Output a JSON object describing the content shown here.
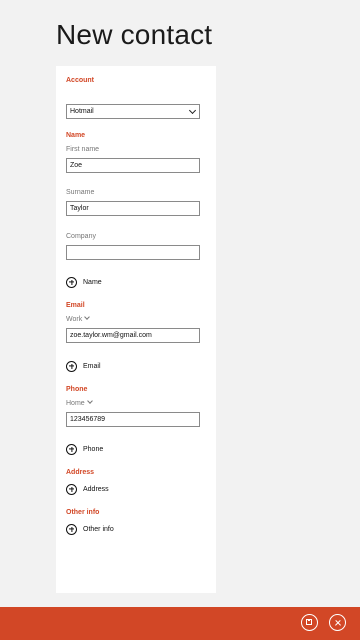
{
  "page": {
    "title": "New contact"
  },
  "form": {
    "account": {
      "section": "Account",
      "selected": "Hotmail"
    },
    "name": {
      "section": "Name",
      "first_name_label": "First name",
      "first_name_value": "Zoe",
      "surname_label": "Surname",
      "surname_value": "Taylor",
      "company_label": "Company",
      "company_value": "",
      "add_label": "Name"
    },
    "email": {
      "section": "Email",
      "type_label": "Work",
      "value": "zoe.taylor.wm@gmail.com",
      "add_label": "Email"
    },
    "phone": {
      "section": "Phone",
      "type_label": "Home",
      "value": "123456789",
      "add_label": "Phone"
    },
    "address": {
      "section": "Address",
      "add_label": "Address"
    },
    "other_info": {
      "section": "Other info",
      "add_label": "Other info"
    }
  },
  "app_bar": {
    "accent_color": "#d24726",
    "buttons": [
      {
        "name": "save",
        "icon": "save-icon"
      },
      {
        "name": "cancel",
        "icon": "close-icon"
      }
    ]
  }
}
